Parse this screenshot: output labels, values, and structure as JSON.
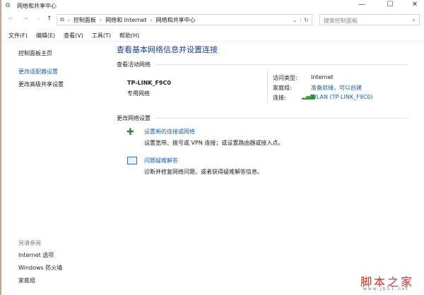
{
  "window": {
    "title": "网络和共享中心",
    "minimize": "—",
    "maximize": "☐",
    "close": "✕"
  },
  "address": {
    "crumbs": [
      "控制面板",
      "网络和 Internet",
      "网络和共享中心"
    ],
    "search_placeholder": "搜索控制面板"
  },
  "menu": [
    "文件(F)",
    "编辑(E)",
    "查看(V)",
    "工具(T)",
    "帮助(H)"
  ],
  "sidebar": {
    "items": [
      "控制面板主页",
      "更改适配器设置",
      "更改高级共享设置"
    ],
    "see_also": "另请参阅",
    "see_also_items": [
      "Internet 选项",
      "Windows 防火墙",
      "家庭组"
    ]
  },
  "main": {
    "heading": "查看基本网络信息并设置连接",
    "active_label": "查看活动网络",
    "network_name": "TP-LINK_F9C0",
    "network_type": "专用网络",
    "access_type_label": "访问类型:",
    "access_type": "Internet",
    "homegroup_label": "家庭组:",
    "homegroup": "准备就绪，可以创建",
    "connection_label": "连接:",
    "connection": "WLAN (TP-LINK_F9C0)",
    "change_label": "更改网络设置",
    "tasks": [
      {
        "title": "设置新的连接或网络",
        "desc": "设置宽带、拨号或 VPN 连接；或设置路由器或接入点。"
      },
      {
        "title": "问题疑难解答",
        "desc": "诊断并修复网络问题，或者获得疑难解答信息。"
      }
    ]
  },
  "watermark": {
    "text": "脚本之家",
    "url": "www.jb51.net"
  }
}
